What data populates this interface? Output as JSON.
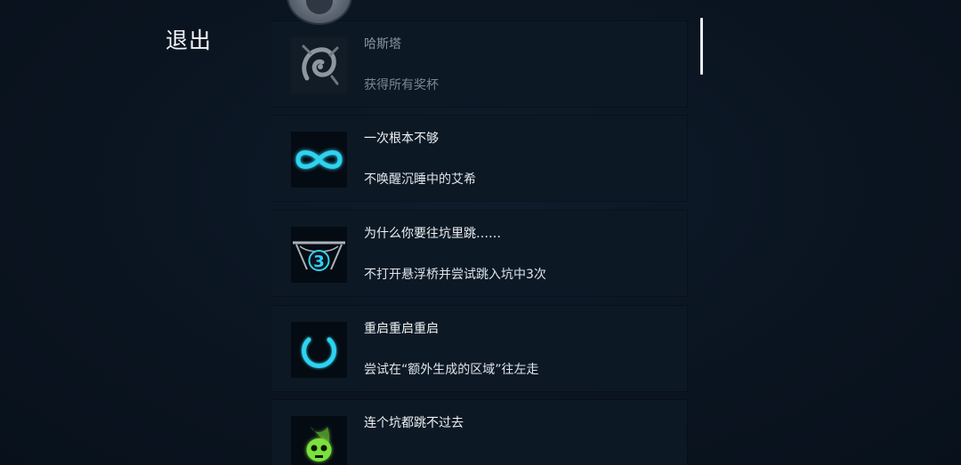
{
  "menu": {
    "exit_label": "退出"
  },
  "achievements": [
    {
      "title": "哈斯塔",
      "description": "获得所有奖杯",
      "icon": "hastur-spiral-icon",
      "locked": true
    },
    {
      "title": "一次根本不够",
      "description": "不唤醒沉睡中的艾希",
      "icon": "infinity-icon",
      "locked": false
    },
    {
      "title": "为什么你要往坑里跳……",
      "description": "不打开悬浮桥并尝试跳入坑中3次",
      "icon": "pit-three-icon",
      "icon_text": "3",
      "locked": false
    },
    {
      "title": "重启重启重启",
      "description": "尝试在“额外生成的区域”往左走",
      "icon": "power-icon",
      "locked": false
    },
    {
      "title": "连个坑都跳不过去",
      "description": "",
      "icon": "green-skull-icon",
      "locked": false
    }
  ],
  "colors": {
    "background": "#0b1623",
    "card": "#0c1925",
    "accent_cyan": "#2fd3f0",
    "accent_green": "#7be03c"
  }
}
